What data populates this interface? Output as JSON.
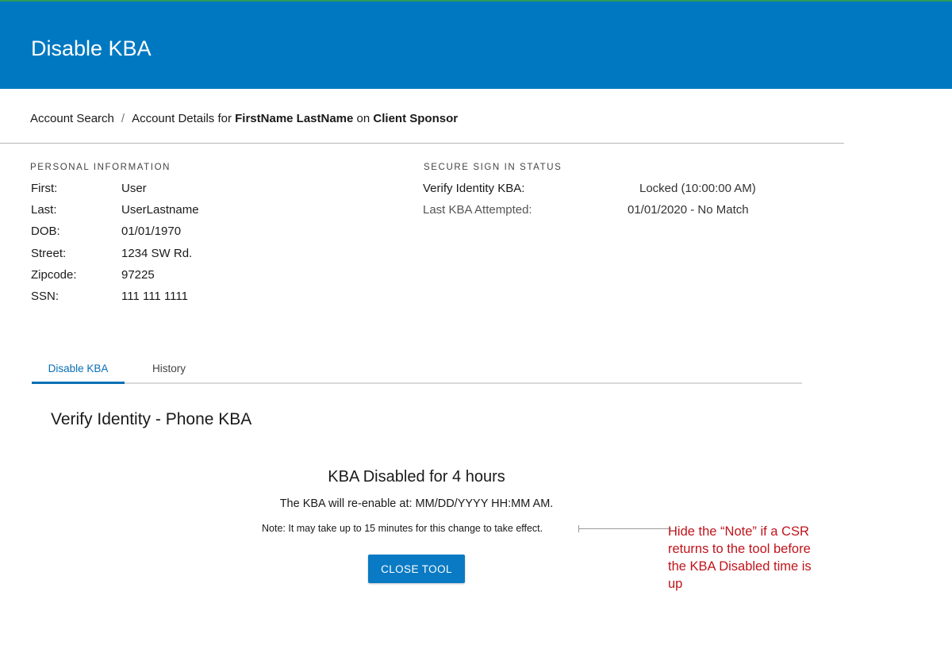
{
  "header": {
    "title": "Disable KBA"
  },
  "breadcrumb": {
    "root": "Account Search",
    "separator": "/",
    "prefix": "Account Details for",
    "name": "FirstName LastName",
    "middle": "on",
    "sponsor": "Client Sponsor"
  },
  "personal": {
    "heading": "PERSONAL INFORMATION",
    "rows": [
      {
        "label": "First:",
        "value": "User"
      },
      {
        "label": "Last:",
        "value": "UserLastname"
      },
      {
        "label": "DOB:",
        "value": "01/01/1970"
      },
      {
        "label": "Street:",
        "value": "1234 SW Rd."
      },
      {
        "label": "Zipcode:",
        "value": "97225"
      },
      {
        "label": "SSN:",
        "value": "111 111 1111"
      }
    ]
  },
  "secure": {
    "heading": "SECURE SIGN IN STATUS",
    "rows": [
      {
        "label": "Verify Identity KBA:",
        "value": "Locked (10:00:00 AM)"
      },
      {
        "label": "Last KBA Attempted:",
        "value": "01/01/2020 - No Match"
      }
    ]
  },
  "tabs": [
    {
      "label": "Disable KBA",
      "active": true
    },
    {
      "label": "History",
      "active": false
    }
  ],
  "panel": {
    "title": "Verify Identity - Phone KBA",
    "status_heading": "KBA Disabled for 4 hours",
    "reenable_text": "The KBA will re-enable at: MM/DD/YYYY HH:MM AM.",
    "note": "Note: It may take up to 15 minutes for this change to take effect.",
    "close_button": "CLOSE TOOL"
  },
  "annotation": {
    "text": "Hide the “Note” if a CSR returns to the tool before the KBA Disabled time is up"
  },
  "colors": {
    "header": "#0078c1",
    "accent": "#0a6fb5",
    "annotation": "#c0141b"
  }
}
